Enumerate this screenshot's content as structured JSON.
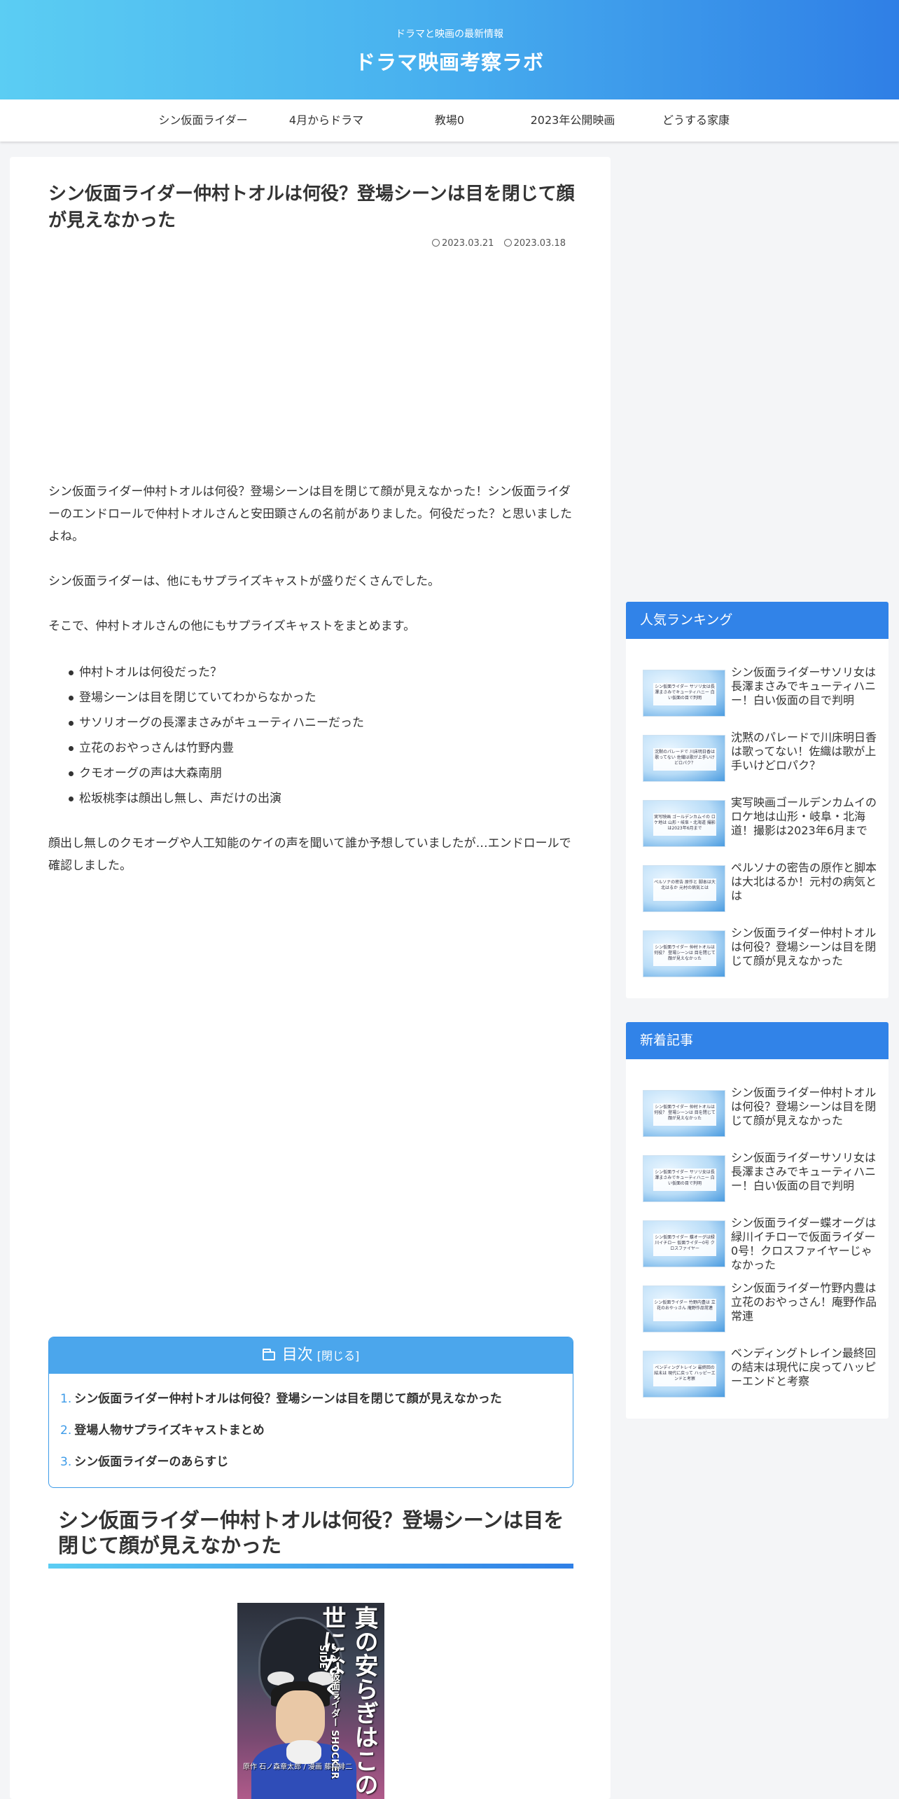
{
  "header": {
    "tagline": "ドラマと映画の最新情報",
    "title": "ドラマ映画考察ラボ"
  },
  "nav": {
    "items": [
      "シン仮面ライダー",
      "4月からドラマ",
      "教場0",
      "2023年公開映画",
      "どうする家康"
    ]
  },
  "article": {
    "title": "シン仮面ライダー仲村トオルは何役？登場シーンは目を閉じて顔が見えなかった",
    "updated_date": "2023.03.21",
    "published_date": "2023.03.18",
    "paragraphs": [
      "シン仮面ライダー仲村トオルは何役？登場シーンは目を閉じて顔が見えなかった！シン仮面ライダーのエンドロールで仲村トオルさんと安田顕さんの名前がありました。何役だった？と思いましたよね。",
      "シン仮面ライダーは、他にもサプライズキャストが盛りだくさんでした。",
      "そこで、仲村トオルさんの他にもサプライズキャストをまとめます。",
      "顔出し無しのクモオーグや人工知能のケイの声を聞いて誰か予想していましたが…エンドロールで確認しました。"
    ],
    "bullets": [
      "仲村トオルは何役だった？",
      "登場シーンは目を閉じていてわからなかった",
      "サソリオーグの長澤まさみがキューティハニーだった",
      "立花のおやっさんは竹野内豊",
      "クモオーグの声は大森南朋",
      "松坂桃李は顔出し無し、声だけの出演"
    ],
    "toc": {
      "title": "目次",
      "toggle": "[閉じる]",
      "items": [
        {
          "num": "1.",
          "label": "シン仮面ライダー仲村トオルは何役？登場シーンは目を閉じて顔が見えなかった"
        },
        {
          "num": "2.",
          "label": "登場人物サプライズキャストまとめ"
        },
        {
          "num": "3.",
          "label": "シン仮面ライダーのあらすじ"
        }
      ]
    },
    "h2": "シン仮面ライダー仲村トオルは何役？登場シーンは目を閉じて顔が見えなかった",
    "cover": {
      "title": "真の安らぎはこの世になく",
      "subtitle": "シン・仮面ライダー SHOCKER SIDE",
      "author": "原作 石ノ森章太郎 / 漫画 藤村緋二"
    }
  },
  "sidebar": {
    "ranking": {
      "heading": "人気ランキング",
      "items": [
        {
          "title": "シン仮面ライダーサソリ女は長澤まさみでキューティハニー！白い仮面の目で判明",
          "thumb": "シン仮面ライダー サソリ女は長澤まさみでキューティハニー 白い仮面の目で判明"
        },
        {
          "title": "沈黙のパレードで川床明日香は歌ってない！佐織は歌が上手いけどロパク？",
          "thumb": "沈黙のパレードで 川床明日香は歌ってない 佐織は歌が上手いけどロパク？"
        },
        {
          "title": "実写映画ゴールデンカムイのロケ地は山形・岐阜・北海道！撮影は2023年6月まで",
          "thumb": "実写映画 ゴールデンカムイの ロケ地は 山形・岐阜・北海道 撮影は2023年6月まで"
        },
        {
          "title": "ペルソナの密告の原作と脚本は大北はるか！元村の病気とは",
          "thumb": "ペルソナの密告 原作と 脚本は大北はるか 元村の病気とは"
        },
        {
          "title": "シン仮面ライダー仲村トオルは何役？登場シーンは目を閉じて顔が見えなかった",
          "thumb": "シン仮面ライダー 仲村トオルは何役？ 登場シーンは 目を閉じて顔が見えなかった"
        }
      ]
    },
    "recent": {
      "heading": "新着記事",
      "items": [
        {
          "title": "シン仮面ライダー仲村トオルは何役？登場シーンは目を閉じて顔が見えなかった",
          "thumb": "シン仮面ライダー 仲村トオルは何役？ 登場シーンは 目を閉じて顔が見えなかった"
        },
        {
          "title": "シン仮面ライダーサソリ女は長澤まさみでキューティハニー！白い仮面の目で判明",
          "thumb": "シン仮面ライダー サソリ女は長澤まさみでキューティハニー 白い仮面の目で判明"
        },
        {
          "title": "シン仮面ライダー蝶オーグは緑川イチローで仮面ライダー0号！クロスファイヤーじゃなかった",
          "thumb": "シン仮面ライダー 蝶オーグは緑川イチロー 仮面ライダー0号 クロスファイヤー"
        },
        {
          "title": "シン仮面ライダー竹野内豊は立花のおやっさん！庵野作品常連",
          "thumb": "シン仮面ライダー 竹野内豊は 立花のおやっさん 庵野作品常連"
        },
        {
          "title": "ベンディングトレイン最終回の結末は現代に戻ってハッピーエンドと考察",
          "thumb": "ペンディングトレイン 最終回の結末は 現代に戻って ハッピーエンドと考察"
        }
      ]
    }
  }
}
